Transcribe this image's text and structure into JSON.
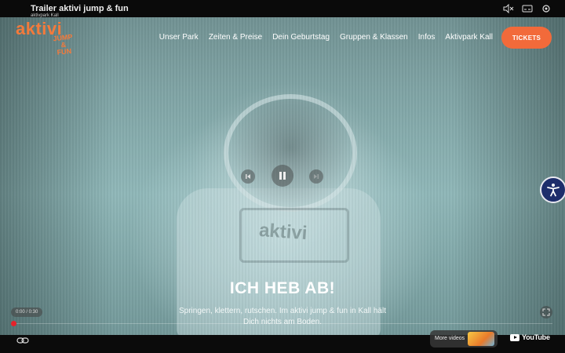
{
  "video": {
    "title": "Trailer aktivi jump & fun",
    "channel": "aktivpark Kall",
    "time": "0:00 / 0:30",
    "more_videos_label": "More videos",
    "youtube_label": "YouTube",
    "icons": [
      "mute-icon",
      "subtitles-icon",
      "settings-icon",
      "previous-icon",
      "pause-icon",
      "next-icon",
      "fullscreen-icon",
      "link-icon"
    ]
  },
  "header": {
    "logo_main": "aktivi",
    "logo_sub": [
      "JUMP",
      "&",
      "FUN"
    ],
    "nav": [
      "Unser Park",
      "Zeiten & Preise",
      "Dein Geburtstag",
      "Gruppen & Klassen",
      "Infos",
      "Aktivpark Kall"
    ],
    "tickets_label": "TICKETS"
  },
  "hero": {
    "title": "ICH HEB AB!",
    "subtitle": "Springen, klettern, rutschen. Im aktivi jump & fun in Kall hält Dich nichts am Boden.",
    "backdrop_logo": "aktivi"
  },
  "colors": {
    "brand_orange": "#f47a3b",
    "tickets_button": "#f26a3a",
    "accessibility_button": "#1d2d6b",
    "progress_red": "#e5212a"
  },
  "progress": 0
}
